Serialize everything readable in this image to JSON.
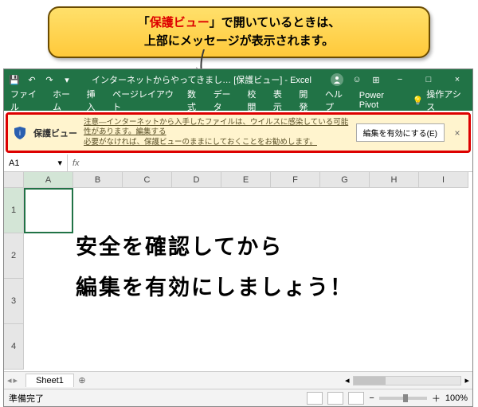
{
  "callout": {
    "line1_prefix": "「",
    "line1_red": "保護ビュー",
    "line1_suffix": "」で開いているときは、",
    "line2": "上部にメッセージが表示されます。"
  },
  "titlebar": {
    "title": "インターネットからやってきまし… [保護ビュー] - Excel"
  },
  "ribbon": {
    "tabs": [
      "ファイル",
      "ホーム",
      "挿入",
      "ページレイアウト",
      "数式",
      "データ",
      "校閲",
      "表示",
      "開発",
      "ヘルプ",
      "Power Pivot"
    ],
    "tell": "操作アシス"
  },
  "protected_view": {
    "label": "保護ビュー",
    "msg_line1": "注意―インターネットから入手したファイルは、ウイルスに感染している可能性があります。編集する",
    "msg_line2": "必要がなければ、保護ビューのままにしておくことをお勧めします。",
    "button": "編集を有効にする(E)",
    "close": "×"
  },
  "namebox": {
    "value": "A1"
  },
  "fx": "fx",
  "columns": [
    "A",
    "B",
    "C",
    "D",
    "E",
    "F",
    "G",
    "H",
    "I"
  ],
  "rows": [
    "1",
    "2",
    "3",
    "4"
  ],
  "overlay": {
    "line1": "安全を確認してから",
    "line2": "編集を有効にしましょう！"
  },
  "sheet_tab": "Sheet1",
  "sheet_plus": "⊕",
  "status": {
    "ready": "準備完了",
    "zoom": "100%"
  },
  "icons": {
    "save": "💾",
    "undo": "↶",
    "redo": "↷",
    "dropdown": "▾",
    "smiley": "☺",
    "min": "−",
    "max": "□",
    "close": "×",
    "chev_left": "◂",
    "chev_right": "▸",
    "tell": "💡",
    "grid": "⊞",
    "zmin": "−",
    "zplus": "＋"
  }
}
